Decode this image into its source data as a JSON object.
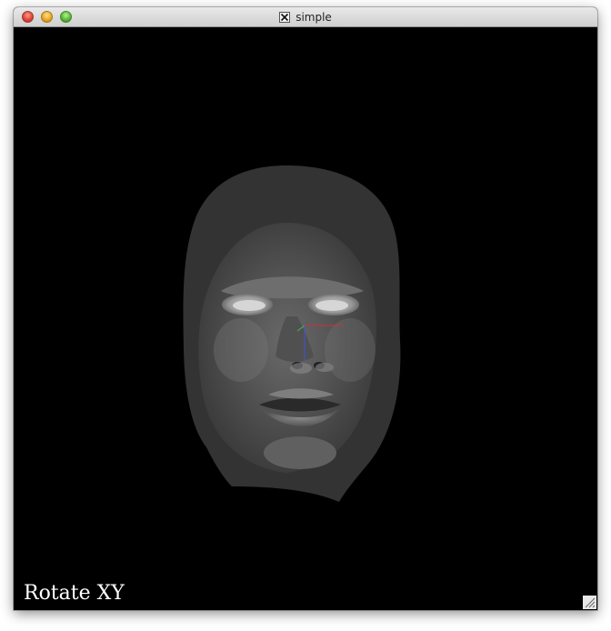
{
  "window": {
    "title": "simple",
    "title_icon": "x11-icon"
  },
  "viewport": {
    "mode_label": "Rotate XY",
    "background": "#000000",
    "content": "3d-face-mesh-render",
    "axes_colors": {
      "x": "#d03030",
      "y": "#40c040",
      "z": "#4050e0"
    }
  },
  "window_controls": [
    "close",
    "minimize",
    "zoom"
  ]
}
